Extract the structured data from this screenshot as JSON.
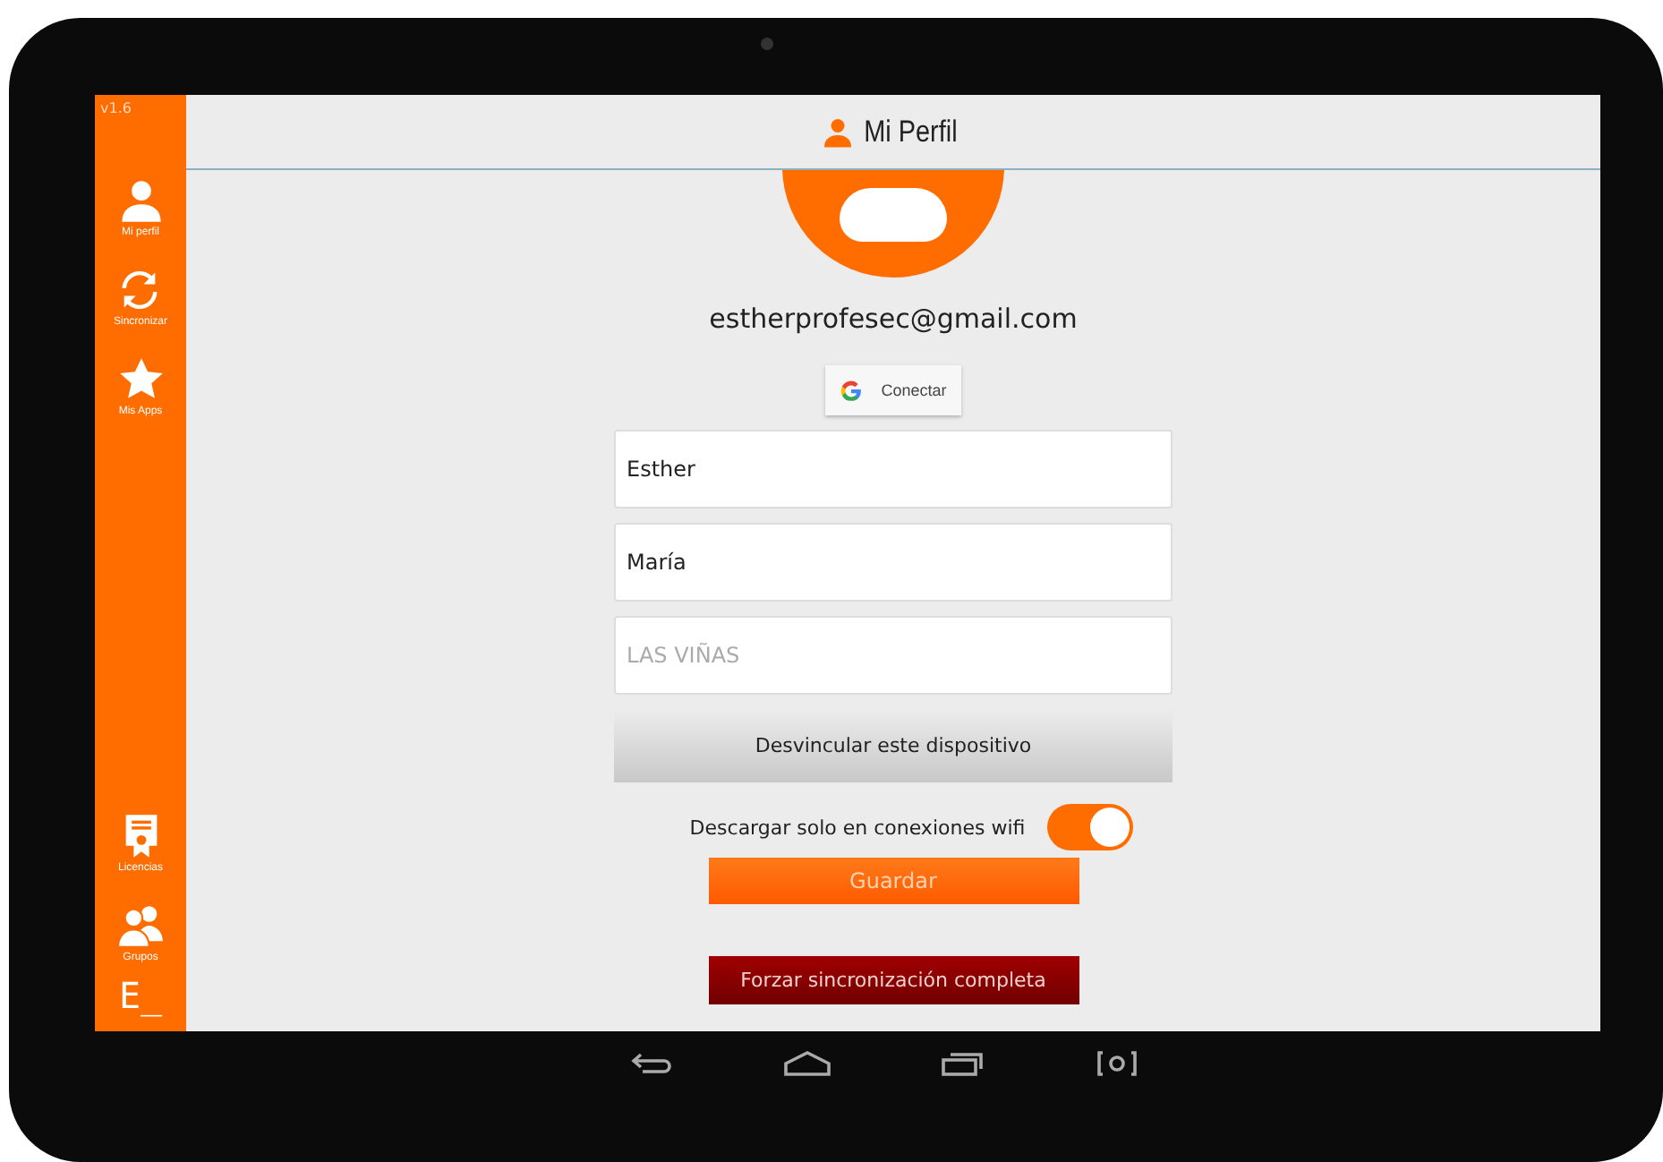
{
  "version": "v1.6",
  "sidebar": {
    "items": [
      {
        "kind": "person",
        "label": "Mi perfil"
      },
      {
        "kind": "sync",
        "label": "Sincronizar"
      },
      {
        "kind": "star",
        "label": "Mis Apps"
      },
      {
        "kind": "gap"
      },
      {
        "kind": "certificate",
        "label": "Licencias"
      },
      {
        "kind": "group",
        "label": "Grupos"
      }
    ],
    "logo": "E_"
  },
  "header": {
    "title": "Mi Perfil"
  },
  "profile": {
    "email": "estherprofesec@gmail.com",
    "connect_button": "Conectar",
    "fields": [
      {
        "value": "Esther"
      },
      {
        "value": "María"
      },
      {
        "placeholder": "LAS VIÑAS"
      }
    ],
    "unlink_button": "Desvincular este dispositivo",
    "wifi_toggle": {
      "label": "Descargar solo en conexiones wifi",
      "on": true
    },
    "save_button": "Guardar",
    "force_sync_button": "Forzar sincronización completa"
  }
}
